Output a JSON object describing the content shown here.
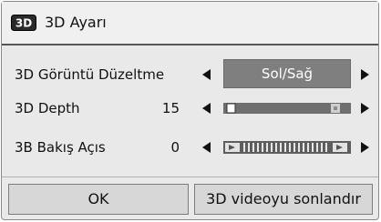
{
  "dialog": {
    "title": "3D Ayarı",
    "title_icon": "3d-badge-icon",
    "title_icon_text": "3D"
  },
  "rows": [
    {
      "label": "3D Görüntü Düzeltme",
      "control": "select",
      "selected": "Sol/Sağ"
    },
    {
      "label": "3D Depth",
      "control": "slider",
      "value": "15",
      "level_fraction": 0.06
    },
    {
      "label": "3B Bakış Açıs",
      "control": "slider",
      "value": "0",
      "level_fraction": 0.5
    }
  ],
  "buttons": {
    "ok_label": "OK",
    "end_label": "3D videoyu sonlandır"
  },
  "colors": {
    "dialog_background": "#e9e9e9",
    "select_background": "#7f7f7f",
    "button_background": "#d7d7d7"
  }
}
